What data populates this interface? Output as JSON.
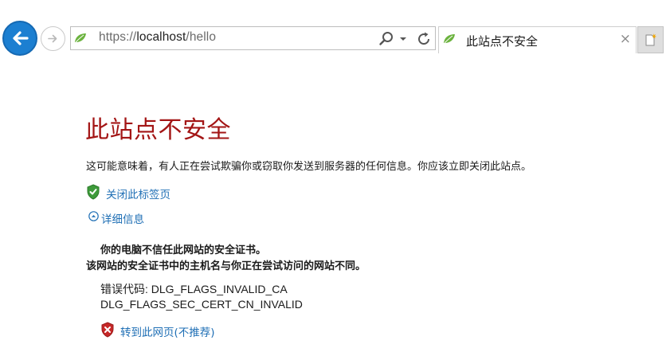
{
  "browser": {
    "url": {
      "prefix": "https://",
      "host": "localhost",
      "path": "/hello"
    },
    "tab": {
      "title": "此站点不安全",
      "close_glyph": "×"
    },
    "icons": {
      "back": "back-arrow-icon",
      "forward": "forward-arrow-icon",
      "site": "leaf-icon",
      "search": "search-icon",
      "dropdown": "chevron-down-icon",
      "refresh": "refresh-icon",
      "new_tab": "new-tab-icon"
    },
    "colors": {
      "back_button": "#1c7fd1",
      "leaf": "#6cb33f"
    }
  },
  "page": {
    "title": "此站点不安全",
    "description": "这可能意味着，有人正在尝试欺骗你或窃取你发送到服务器的任何信息。你应该立即关闭此站点。",
    "close_tab_link": "关闭此标签页",
    "more_info_link": "详细信息",
    "cert_message_1": "你的电脑不信任此网站的安全证书。",
    "cert_message_2": "该网站的安全证书中的主机名与你正在尝试访问的网站不同。",
    "error_code_line1": "错误代码: DLG_FLAGS_INVALID_CA",
    "error_code_line2": "DLG_FLAGS_SEC_CERT_CN_INVALID",
    "goto_link": "转到此网页(不推荐)",
    "colors": {
      "title": "#a31515",
      "link": "#1f6fb5"
    }
  }
}
